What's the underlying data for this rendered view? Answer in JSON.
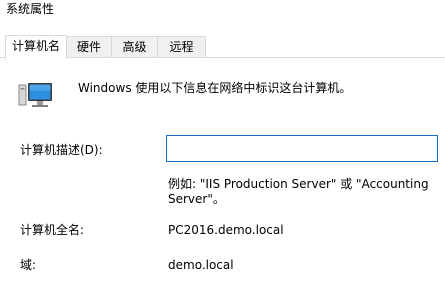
{
  "window": {
    "title": "系统属性"
  },
  "tabs": [
    {
      "label": "计算机名",
      "active": true
    },
    {
      "label": "硬件",
      "active": false
    },
    {
      "label": "高级",
      "active": false
    },
    {
      "label": "远程",
      "active": false
    }
  ],
  "panel": {
    "intro_text": "Windows 使用以下信息在网络中标识这台计算机。",
    "icon": "computer-icon",
    "description_label": "计算机描述(D):",
    "description_value": "",
    "description_example": "例如: \"IIS Production Server\" 或 \"Accounting Server\"。",
    "full_name_label": "计算机全名:",
    "full_name_value": "PC2016.demo.local",
    "domain_label": "域:",
    "domain_value": "demo.local"
  },
  "colors": {
    "input_border": "#1e6fc9",
    "tab_border": "#d9d9d9",
    "tab_inactive_bg": "#f0f0f0"
  }
}
